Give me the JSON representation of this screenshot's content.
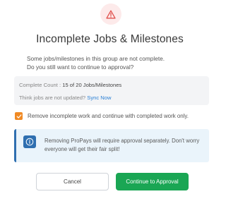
{
  "dialog": {
    "icon": "warning-triangle-icon",
    "title": "Incomplete Jobs & Milestones",
    "message_line1": "Some jobs/milestones in this group are not complete.",
    "message_line2": "Do you still want to continue to approval?"
  },
  "count": {
    "label": "Complete Count :",
    "value": "15 of 20 Jobs/Milestones",
    "not_updated_text": "Think jobs are not updated?",
    "sync_label": "Sync Now"
  },
  "checkbox": {
    "checked": true,
    "label": "Remove incomplete work and continue with completed work only."
  },
  "info": {
    "icon": "info-icon",
    "text": "Removing ProPays will require approval separately. Don't worry everyone will get their fair split!"
  },
  "buttons": {
    "cancel_label": "Cancel",
    "approve_label": "Continue to Approval"
  },
  "colors": {
    "warning": "#e0504c",
    "warning_bg": "#fdeaea",
    "checkbox": "#f08a24",
    "link": "#2a7fd4",
    "info_accent": "#2f6fb0",
    "info_bg": "#eaf4fb",
    "approve": "#1aa654"
  }
}
